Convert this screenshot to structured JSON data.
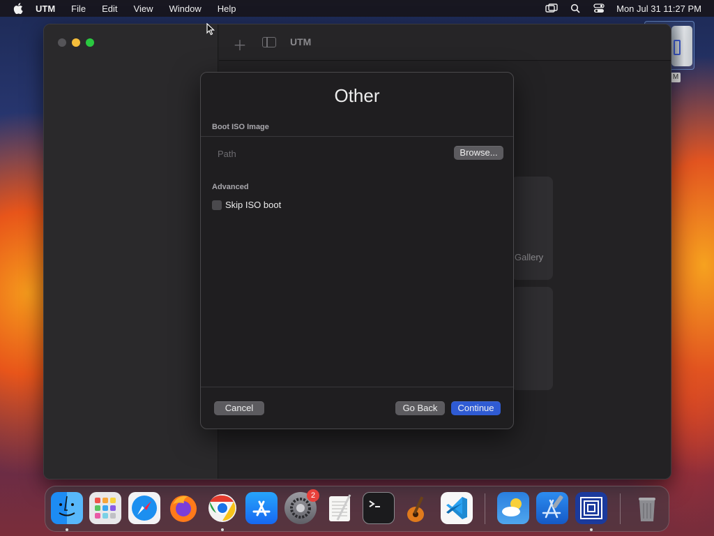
{
  "menubar": {
    "app_name": "UTM",
    "items": [
      "File",
      "Edit",
      "View",
      "Window",
      "Help"
    ],
    "clock": "Mon Jul 31  11:27 PM"
  },
  "desktop": {
    "disk_label": "M"
  },
  "window": {
    "toolbar_title": "UTM",
    "background_card_label": "Gallery"
  },
  "sheet": {
    "title": "Other",
    "boot_section_label": "Boot ISO Image",
    "path_placeholder": "Path",
    "path_value": "",
    "browse_label": "Browse...",
    "advanced_section_label": "Advanced",
    "skip_iso_label": "Skip ISO boot",
    "skip_iso_checked": false,
    "cancel_label": "Cancel",
    "go_back_label": "Go Back",
    "continue_label": "Continue"
  },
  "dock": {
    "items": [
      {
        "name": "finder",
        "running": true
      },
      {
        "name": "launchpad",
        "running": false
      },
      {
        "name": "safari",
        "running": false
      },
      {
        "name": "firefox",
        "running": false
      },
      {
        "name": "chrome",
        "running": true
      },
      {
        "name": "app-store",
        "running": false
      },
      {
        "name": "system-settings",
        "running": false,
        "badge": "2"
      },
      {
        "name": "textedit",
        "running": false
      },
      {
        "name": "terminal",
        "running": false
      },
      {
        "name": "garageband",
        "running": false
      },
      {
        "name": "vscode",
        "running": false
      },
      {
        "name": "weather",
        "running": false
      },
      {
        "name": "xcode",
        "running": false
      },
      {
        "name": "utm",
        "running": true
      },
      {
        "name": "trash",
        "running": false
      }
    ]
  },
  "colors": {
    "accent": "#2f5bd3",
    "traffic_close": "#555458",
    "traffic_min": "#f5bd3b",
    "traffic_max": "#2ac840",
    "badge": "#e8413b"
  }
}
